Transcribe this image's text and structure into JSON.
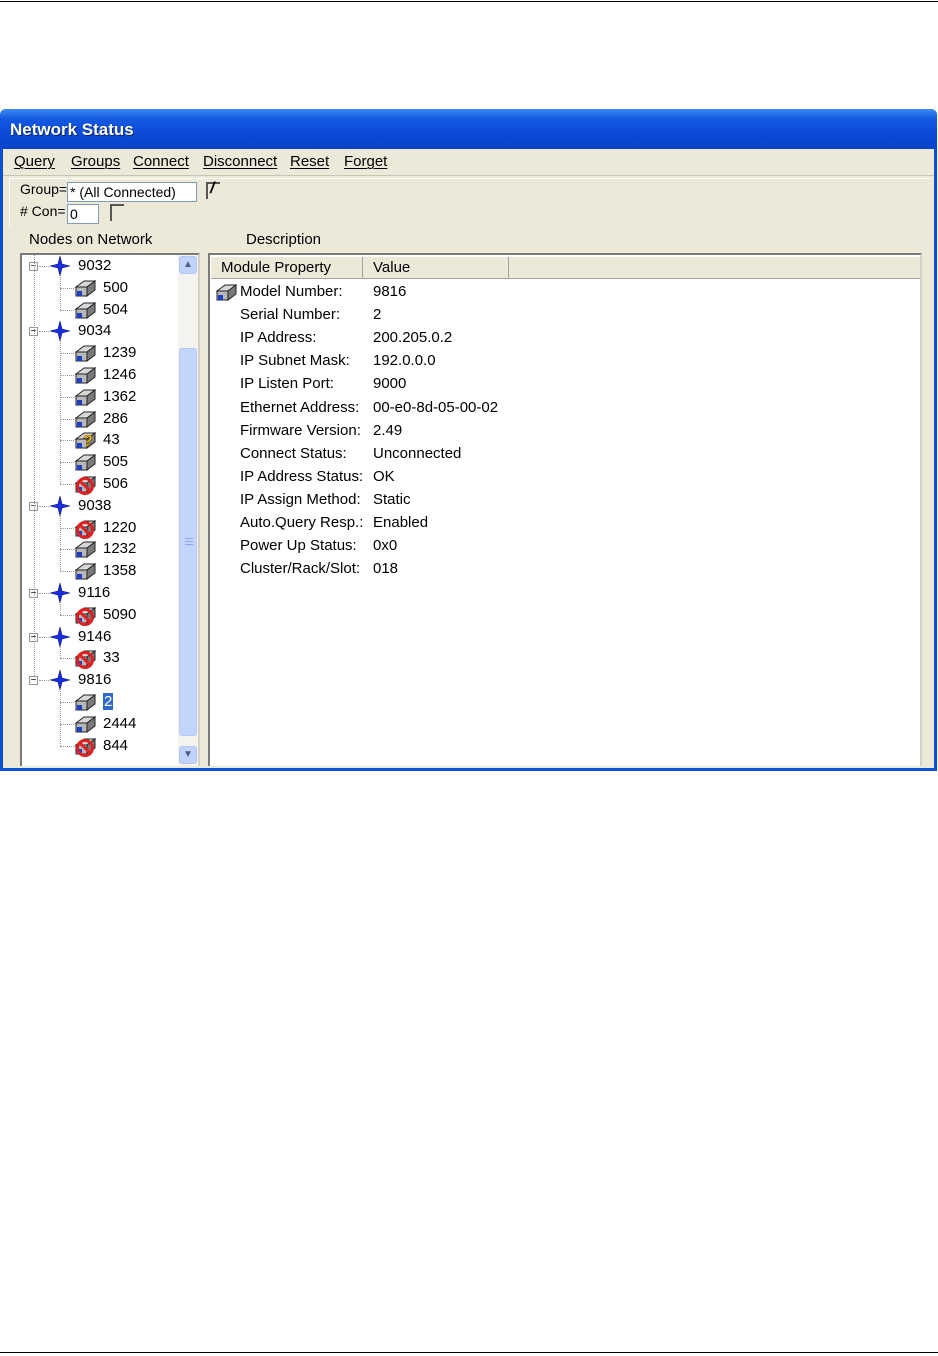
{
  "window": {
    "title": "Network Status"
  },
  "menu": [
    "Query",
    "Groups",
    "Connect",
    "Disconnect",
    "Reset",
    "Forget"
  ],
  "toolbar": {
    "group_label": "Group=",
    "group_value": "* (All Connected)",
    "slash": "/",
    "con_label": "# Con=",
    "con_value": "0"
  },
  "panels": {
    "left_label": "Nodes on Network",
    "right_label": "Description"
  },
  "tree": [
    {
      "label": "9032",
      "level": 0,
      "icon": "network-star-icon"
    },
    {
      "label": "500",
      "level": 1,
      "icon": "module-icon"
    },
    {
      "label": "504",
      "level": 1,
      "icon": "module-icon"
    },
    {
      "label": "9034",
      "level": 0,
      "icon": "network-star-icon"
    },
    {
      "label": "1239",
      "level": 1,
      "icon": "module-icon"
    },
    {
      "label": "1246",
      "level": 1,
      "icon": "module-icon"
    },
    {
      "label": "1362",
      "level": 1,
      "icon": "module-icon"
    },
    {
      "label": "286",
      "level": 1,
      "icon": "module-icon"
    },
    {
      "label": "43",
      "level": 1,
      "icon": "module-unknown-icon"
    },
    {
      "label": "505",
      "level": 1,
      "icon": "module-icon"
    },
    {
      "label": "506",
      "level": 1,
      "icon": "module-error-icon"
    },
    {
      "label": "9038",
      "level": 0,
      "icon": "network-star-icon"
    },
    {
      "label": "1220",
      "level": 1,
      "icon": "module-error-icon"
    },
    {
      "label": "1232",
      "level": 1,
      "icon": "module-icon"
    },
    {
      "label": "1358",
      "level": 1,
      "icon": "module-icon"
    },
    {
      "label": "9116",
      "level": 0,
      "icon": "network-star-icon"
    },
    {
      "label": "5090",
      "level": 1,
      "icon": "module-error-icon"
    },
    {
      "label": "9146",
      "level": 0,
      "icon": "network-star-icon"
    },
    {
      "label": "33",
      "level": 1,
      "icon": "module-error-icon"
    },
    {
      "label": "9816",
      "level": 0,
      "icon": "network-star-icon"
    },
    {
      "label": "2",
      "level": 1,
      "icon": "module-icon",
      "selected": true
    },
    {
      "label": "2444",
      "level": 1,
      "icon": "module-icon"
    },
    {
      "label": "844",
      "level": 1,
      "icon": "module-error-icon"
    }
  ],
  "table": {
    "headers": [
      "Module Property",
      "Value"
    ],
    "rows": [
      [
        "Model Number:",
        "9816"
      ],
      [
        "Serial Number:",
        "2"
      ],
      [
        "IP Address:",
        "200.205.0.2"
      ],
      [
        "IP Subnet Mask:",
        "192.0.0.0"
      ],
      [
        "IP Listen Port:",
        "9000"
      ],
      [
        "Ethernet Address:",
        "00-e0-8d-05-00-02"
      ],
      [
        "Firmware Version:",
        "2.49"
      ],
      [
        "Connect Status:",
        "Unconnected"
      ],
      [
        "IP Address Status:",
        "OK"
      ],
      [
        "IP Assign Method:",
        "Static"
      ],
      [
        "Auto.Query Resp.:",
        "Enabled"
      ],
      [
        "Power Up Status:",
        "0x0"
      ],
      [
        "Cluster/Rack/Slot:",
        "018"
      ]
    ]
  },
  "colors": {
    "titlebar": "#0a4fd8",
    "selection": "#316ac5",
    "star": "#1a2ee0",
    "error": "#e02020",
    "unknown": "#f2c21a"
  }
}
